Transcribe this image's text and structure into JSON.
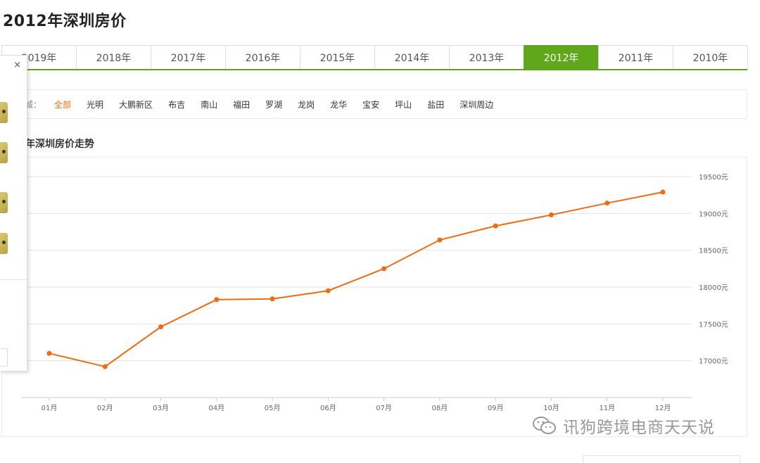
{
  "page": {
    "title": "2012年深圳房价"
  },
  "year_tabs": {
    "items": [
      "2019年",
      "2018年",
      "2017年",
      "2016年",
      "2015年",
      "2014年",
      "2013年",
      "2012年",
      "2011年",
      "2010年"
    ],
    "active": "2012年"
  },
  "district_filter": {
    "label": "城：",
    "items": [
      "全部",
      "光明",
      "大鹏新区",
      "布吉",
      "南山",
      "福田",
      "罗湖",
      "龙岗",
      "龙华",
      "宝安",
      "坪山",
      "盐田",
      "深圳周边"
    ],
    "active": "全部"
  },
  "section_title": "年深圳房价走势",
  "side_panel": {
    "close_symbol": "×"
  },
  "watermark": {
    "text": "讯狗跨境电商天天说",
    "icon": "wechat-icon"
  },
  "colors": {
    "accent_green": "#5fa81c",
    "line_orange": "#f26a10",
    "highlight_orange": "#f26a10"
  },
  "chart_data": {
    "type": "line",
    "categories": [
      "01月",
      "02月",
      "03月",
      "04月",
      "05月",
      "06月",
      "07月",
      "08月",
      "09月",
      "10月",
      "11月",
      "12月"
    ],
    "series": [
      {
        "values": [
          17100,
          16920,
          17460,
          17830,
          17840,
          17950,
          18250,
          18640,
          18830,
          18980,
          19140,
          19290
        ]
      }
    ],
    "y_ticks": [
      17000,
      17500,
      18000,
      18500,
      19000,
      19500
    ],
    "y_tick_suffix": "元",
    "y_axis_position": "right",
    "ylim": [
      16500,
      19500
    ],
    "grid": true,
    "title": "",
    "xlabel": "",
    "ylabel": ""
  }
}
